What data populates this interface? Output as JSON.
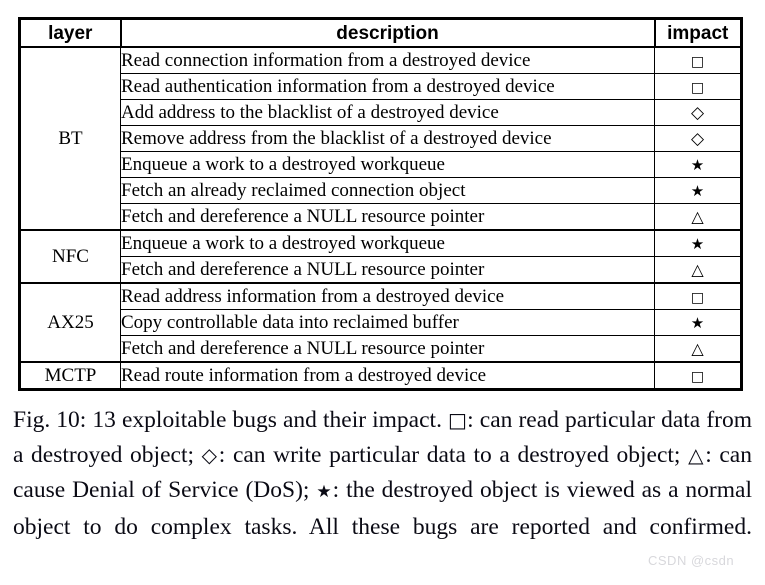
{
  "figure": {
    "table": {
      "columns": [
        {
          "key": "layer",
          "label": "layer"
        },
        {
          "key": "description",
          "label": "description"
        },
        {
          "key": "impact",
          "label": "impact"
        }
      ],
      "groups": [
        {
          "layer": "BT",
          "rows": [
            {
              "description": "Read connection information from a destroyed device",
              "impact": "□",
              "impact_name": "square"
            },
            {
              "description": "Read authentication information from a destroyed device",
              "impact": "□",
              "impact_name": "square"
            },
            {
              "description": "Add address to the blacklist of a destroyed device",
              "impact": "◇",
              "impact_name": "diamond"
            },
            {
              "description": "Remove address from the blacklist of a destroyed device",
              "impact": "◇",
              "impact_name": "diamond"
            },
            {
              "description": "Enqueue a work to a destroyed workqueue",
              "impact": "★",
              "impact_name": "star"
            },
            {
              "description": "Fetch an already reclaimed connection object",
              "impact": "★",
              "impact_name": "star"
            },
            {
              "description": "Fetch and dereference a NULL resource pointer",
              "impact": "△",
              "impact_name": "triangle"
            }
          ]
        },
        {
          "layer": "NFC",
          "rows": [
            {
              "description": "Enqueue a work to a destroyed workqueue",
              "impact": "★",
              "impact_name": "star"
            },
            {
              "description": "Fetch and dereference a NULL resource pointer",
              "impact": "△",
              "impact_name": "triangle"
            }
          ]
        },
        {
          "layer": "AX25",
          "rows": [
            {
              "description": "Read address information from a destroyed device",
              "impact": "□",
              "impact_name": "square"
            },
            {
              "description": "Copy controllable data into reclaimed buffer",
              "impact": "★",
              "impact_name": "star"
            },
            {
              "description": "Fetch and dereference a NULL resource pointer",
              "impact": "△",
              "impact_name": "triangle"
            }
          ]
        },
        {
          "layer": "MCTP",
          "rows": [
            {
              "description": "Read route information from a destroyed device",
              "impact": "□",
              "impact_name": "square"
            }
          ]
        }
      ]
    },
    "caption": {
      "parts": [
        {
          "type": "text",
          "value": "Fig. 10: 13 exploitable bugs and their impact. "
        },
        {
          "type": "glyph",
          "value": "□",
          "glyph_name": "square"
        },
        {
          "type": "text",
          "value": ": can read particular data from a destroyed object; "
        },
        {
          "type": "glyph",
          "value": "◇",
          "glyph_name": "diamond"
        },
        {
          "type": "text",
          "value": ": can write particular data to a destroyed object; "
        },
        {
          "type": "glyph",
          "value": "△",
          "glyph_name": "triangle"
        },
        {
          "type": "text",
          "value": ": can cause Denial of Service (DoS); "
        },
        {
          "type": "glyph",
          "value": "★",
          "glyph_name": "star"
        },
        {
          "type": "text",
          "value": ": the destroyed object is viewed as a normal object to do complex tasks. All these bugs are reported and confirmed."
        }
      ],
      "plain": "Fig. 10: 13 exploitable bugs and their impact. □: can read particular data from a destroyed object; ◇: can write particular data to a destroyed object; △: can cause Denial of Service (DoS); ★: the destroyed object is viewed as a normal object to do complex tasks. All these bugs are reported and confirmed."
    },
    "watermark": {
      "text": "CSDN @csdn",
      "color": "#d8d8dc"
    }
  }
}
